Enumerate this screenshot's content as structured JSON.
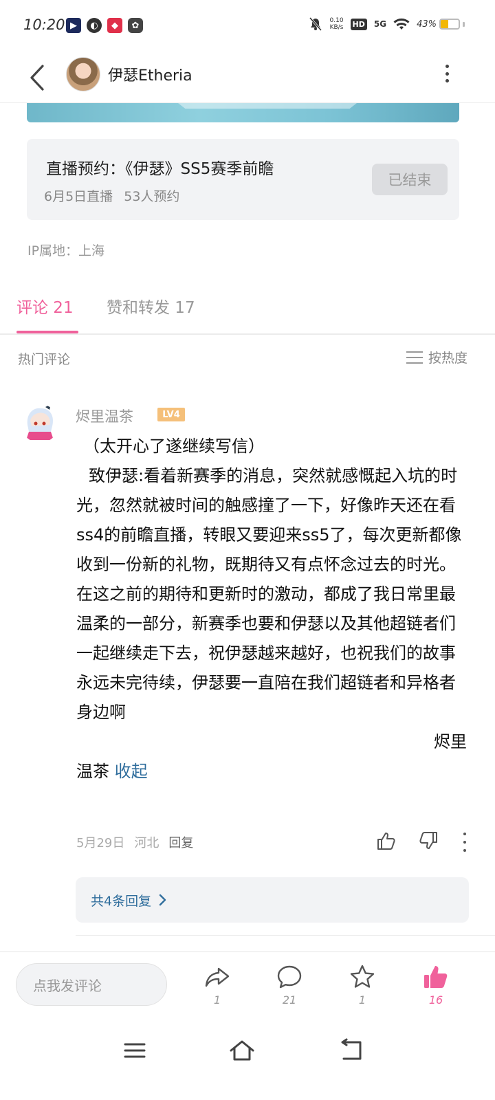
{
  "status_bar": {
    "time": "10:20",
    "net_speed_value": "0.10",
    "net_speed_unit": "KB/s",
    "hd": "HD",
    "network": "5G",
    "battery": "43%",
    "battery_level": 0.43
  },
  "header": {
    "user_name": "伊瑟Etheria"
  },
  "live_card": {
    "title": "直播预约：《伊瑟》SS5赛季前瞻",
    "date": "6月5日直播",
    "reservations": "53人预约",
    "status_button": "已结束"
  },
  "ip_location": "IP属地：上海",
  "tabs": [
    {
      "label": "评论 21"
    },
    {
      "label": "赞和转发 17"
    }
  ],
  "comments_section": {
    "hot_label": "热门评论",
    "sort_label": "按热度"
  },
  "comment": {
    "author": "烬里温茶",
    "level": "LV4",
    "paragraph_1": "（太开心了遂继续写信）",
    "paragraph_2": "致伊瑟:看着新赛季的消息，突然就感慨起入坑的时光，忽然就被时间的触感撞了一下，好像昨天还在看ss4的前瞻直播，转眼又要迎来ss5了，每次更新都像收到一份新的礼物，既期待又有点怀念过去的时光。在这之前的期待和更新时的激动，都成了我日常里最温柔的一部分，新赛季也要和伊瑟以及其他超链者们一起继续走下去，祝伊瑟越来越好，也祝我们的故事永远未完待续，伊瑟要一直陪在我们超链者和异格者身边啊",
    "signature_line1": "烬里",
    "signature_line2": "温茶",
    "collapse_label": "收起",
    "date": "5月29日",
    "location": "河北",
    "reply_label": "回复",
    "replies_link": "共4条回复"
  },
  "action_bar": {
    "input_placeholder": "点我发评论",
    "share_count": "1",
    "comment_count": "21",
    "favorite_count": "1",
    "like_count": "16",
    "accent_color": "#f0619b"
  }
}
